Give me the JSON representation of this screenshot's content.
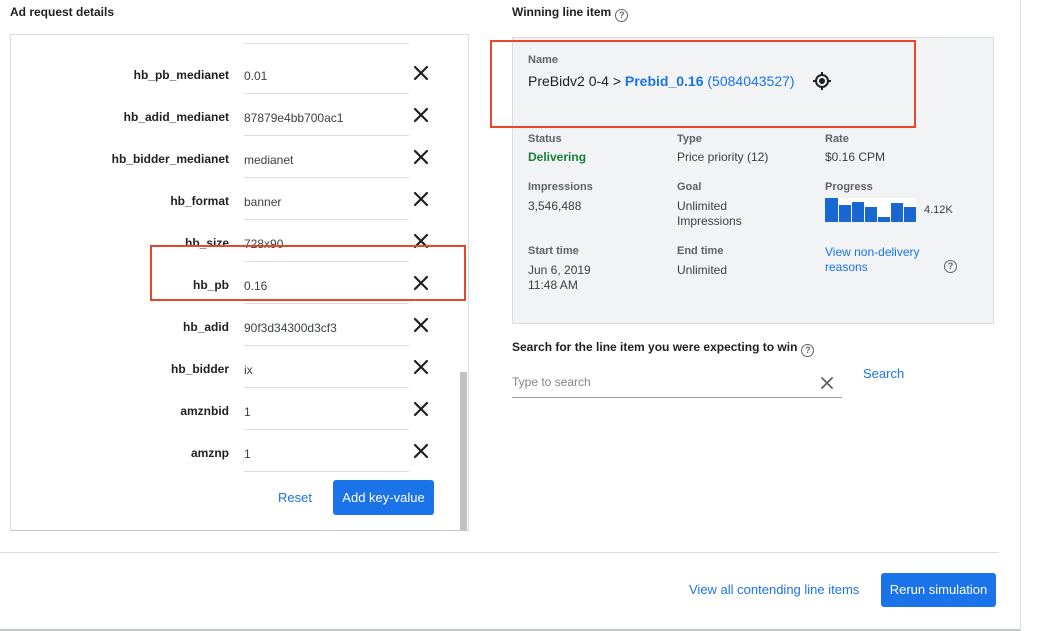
{
  "left": {
    "title": "Ad request details",
    "rows": [
      {
        "key": "hb_pb_medianet",
        "value": "0.01"
      },
      {
        "key": "hb_adid_medianet",
        "value": "87879e4bb700ac1"
      },
      {
        "key": "hb_bidder_medianet",
        "value": "medianet"
      },
      {
        "key": "hb_format",
        "value": "banner"
      },
      {
        "key": "hb_size",
        "value": "728x90"
      },
      {
        "key": "hb_pb",
        "value": "0.16"
      },
      {
        "key": "hb_adid",
        "value": "90f3d34300d3cf3"
      },
      {
        "key": "hb_bidder",
        "value": "ix"
      },
      {
        "key": "amznbid",
        "value": "1"
      },
      {
        "key": "amznp",
        "value": "1"
      }
    ],
    "reset_label": "Reset",
    "add_label": "Add key-value"
  },
  "right": {
    "title": "Winning line item",
    "name_label": "Name",
    "name_order": "PreBidv2 0-4 >",
    "name_link": "Prebid_0.16",
    "name_id": "(5084043527)",
    "status_label": "Status",
    "status_value": "Delivering",
    "type_label": "Type",
    "type_value": "Price priority (12)",
    "rate_label": "Rate",
    "rate_value": "$0.16 CPM",
    "impressions_label": "Impressions",
    "impressions_value": "3,546,488",
    "goal_label": "Goal",
    "goal_value_1": "Unlimited",
    "goal_value_2": "Impressions",
    "progress_label": "Progress",
    "progress_value": "4.12K",
    "start_label": "Start time",
    "start_value_1": "Jun 6, 2019",
    "start_value_2": "11:48 AM",
    "end_label": "End time",
    "end_value": "Unlimited",
    "nondelivery_1": "View non-delivery",
    "nondelivery_2": "reasons"
  },
  "search": {
    "title": "Search for the line item you were expecting to win",
    "placeholder": "Type to search",
    "button_label": "Search"
  },
  "footer": {
    "view_all_label": "View all contending line items",
    "rerun_label": "Rerun simulation"
  },
  "colors": {
    "accent": "#1a73e8",
    "highlight": "#e8472b",
    "status_ok": "#188038"
  }
}
